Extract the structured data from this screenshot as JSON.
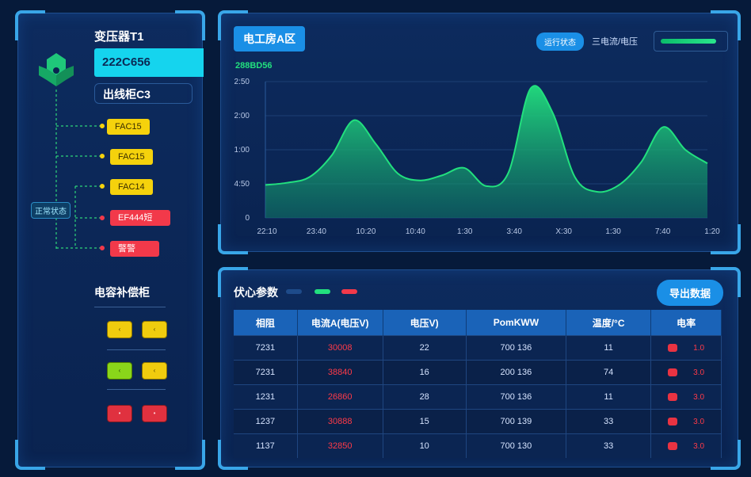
{
  "left": {
    "transformer_title": "变压器T1",
    "transformer_code": "222C656",
    "cabinet_label": "出线柜C3",
    "state_badge": "正常状态",
    "branches": [
      {
        "label": "FAC15",
        "color": "yellow"
      },
      {
        "label": "FAC15",
        "color": "yellow"
      },
      {
        "label": "FAC14",
        "color": "yellow"
      },
      {
        "label": "EF444短",
        "color": "red"
      },
      {
        "label": "警警",
        "color": "red"
      }
    ],
    "capacitor_title": "电容补偿柜",
    "capacitor_buttons": [
      {
        "label": "‹",
        "color": "y"
      },
      {
        "label": "‹",
        "color": "y"
      },
      {
        "label": "‹",
        "color": "g"
      },
      {
        "label": "‹",
        "color": "y"
      },
      {
        "label": "•",
        "color": "r"
      },
      {
        "label": "•",
        "color": "r"
      }
    ]
  },
  "chart_header": {
    "area_title": "电工房A区",
    "status_button": "运行状态",
    "mode_label": "三电流/电压",
    "progress_fraction": 0.76,
    "series_code": "288BD56"
  },
  "chart_data": {
    "type": "area",
    "x": [
      "22:10",
      "23:40",
      "10:20",
      "10:40",
      "1:30",
      "3:40",
      "X:30",
      "1:30",
      "7:40",
      "1:20"
    ],
    "y_ticks": [
      "0",
      "4:50",
      "1:00",
      "2:00",
      "2:50"
    ],
    "ylim": [
      0,
      2.4
    ],
    "values": [
      0.58,
      0.62,
      0.72,
      1.1,
      1.72,
      1.3,
      0.78,
      0.66,
      0.75,
      0.88,
      0.56,
      0.8,
      2.28,
      1.85,
      0.72,
      0.46,
      0.58,
      0.98,
      1.6,
      1.2,
      0.96
    ],
    "series_color": "#22e07e"
  },
  "table": {
    "title": "伏心参数",
    "legend_colors": [
      "#1e4b8a",
      "#22e07e",
      "#f2394a"
    ],
    "export_button": "导出数据",
    "headers": [
      "相阻",
      "电流A(电压V)",
      "电压V)",
      "PomKWW",
      "温度/°C",
      "电率"
    ],
    "rows": [
      [
        "7231",
        "30008",
        "22",
        "700 136",
        "11",
        "1.0"
      ],
      [
        "7231",
        "38840",
        "16",
        "200 136",
        "74",
        "3.0"
      ],
      [
        "1231",
        "26860",
        "28",
        "700 136",
        "11",
        "3.0"
      ],
      [
        "1237",
        "30888",
        "15",
        "700 139",
        "33",
        "3.0"
      ],
      [
        "1137",
        "32850",
        "10",
        "700 130",
        "33",
        "3.0"
      ]
    ]
  },
  "colors": {
    "accent": "#1a8fe6",
    "cyan": "#15d4ee",
    "alarm": "#f2394a",
    "warning": "#f5d20c",
    "ok": "#22e07e"
  }
}
